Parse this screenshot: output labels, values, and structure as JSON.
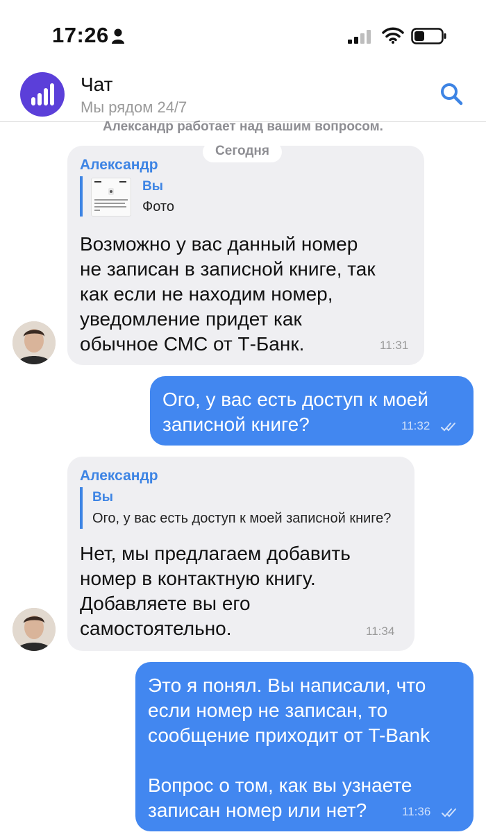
{
  "status_bar": {
    "time": "17:26"
  },
  "header": {
    "title": "Чат",
    "subtitle": "Мы рядом 24/7"
  },
  "typing_status": "Александр работает над вашим вопросом.",
  "date_divider": "Сегодня",
  "messages": [
    {
      "sender": "Александр",
      "reply_to": {
        "name": "Вы",
        "text": "Фото"
      },
      "text": "Возможно у вас данный номер\nне записан в записной книге, так\nкак если не находим номер,\nуведомление придет как\nобычное СМС от Т-Банк.",
      "time": "11:31"
    },
    {
      "text": "Ого, у вас есть доступ к моей\nзаписной книге?",
      "time": "11:32"
    },
    {
      "sender": "Александр",
      "reply_to": {
        "name": "Вы",
        "text": "Ого, у вас есть доступ к моей записной книге?"
      },
      "text": "Нет, мы предлагаем добавить\nномер в контактную книгу.\nДобавляете вы его\nсамостоятельно.",
      "time": "11:34"
    },
    {
      "text": "Это я понял. Вы написали, что\nесли номер не записан, то\nсообщение приходит от T-Bank\n\nВопрос о том, как вы узнаете\nзаписан номер или нет?",
      "time": "11:36"
    }
  ],
  "colors": {
    "accent": "#3d84e4",
    "outgoing": "#4287f0",
    "incoming": "#efeff2",
    "logo": "#5b3fd9"
  }
}
